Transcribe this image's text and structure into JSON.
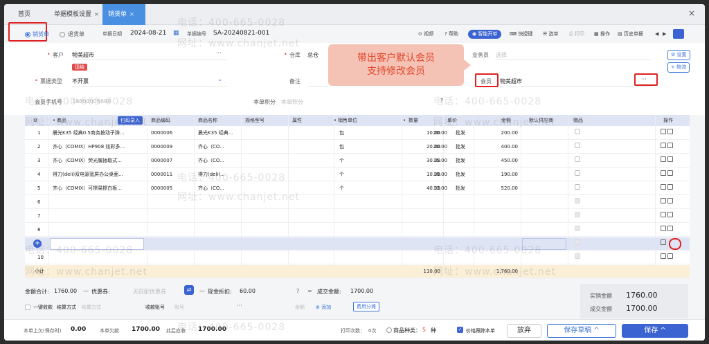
{
  "tabs": [
    {
      "label": "首页"
    },
    {
      "label": "单据模板设置",
      "close": "×"
    },
    {
      "label": "销货单",
      "close": "×"
    }
  ],
  "window_close": "×",
  "toolbar": {
    "doc_type_a": "销货单",
    "doc_type_b": "退货单",
    "date_label": "单据日期",
    "date_value": "2024-08-21",
    "number_label": "单据编号",
    "number_value": "SA-20240821-001",
    "video": "视频",
    "help": "帮助",
    "smart": "智能开单",
    "shortcut": "快捷键",
    "select": "选单",
    "print": "打印",
    "action": "操作",
    "history": "历史单据"
  },
  "form": {
    "customer_label": "客户",
    "customer_value": "物美超市",
    "customer_tag": "现结",
    "warehouse_label": "仓库",
    "warehouse_value": "总仓",
    "salesman_label": "业务员",
    "salesman_placeholder": "选择",
    "invoice_label": "票据类型",
    "invoice_value": "不开票",
    "remark_label": "备注",
    "member_label": "会员",
    "member_value": "物美超市",
    "phone_label": "会员手机号",
    "phone_value": "18800008898",
    "points_label": "本单积分",
    "points_value": "本单积分",
    "more": "···",
    "settings_btn": "设置",
    "logistics_btn": "+ 物流"
  },
  "callout": {
    "line1": "带出客户默认会员",
    "line2": "支持修改会员"
  },
  "table": {
    "headers": {
      "product": "商品",
      "scan": "扫码录入",
      "code": "商品编码",
      "name": "商品名称",
      "spec": "规格型号",
      "attr": "属性",
      "unit": "销售单位",
      "qty": "数量",
      "price": "单价",
      "amount": "金额",
      "supplier": "默认供应商",
      "gift": "赠品",
      "ops": "操作"
    },
    "price_tag": "批发",
    "rows": [
      {
        "no": "1",
        "product": "晨光K35 经典0.5商务按动子弹...",
        "code": "0000006",
        "name": "晨光K35 经典...",
        "unit": "包",
        "qty": "10.00",
        "price": "20.00",
        "amount": "200.00"
      },
      {
        "no": "2",
        "product": "齐心（COMIX）HP908 炫彩多...",
        "code": "0000009",
        "name": "齐心（CO...",
        "unit": "包",
        "qty": "20.00",
        "price": "20.00",
        "amount": "400.00"
      },
      {
        "no": "3",
        "product": "齐心（COMIX）荧光膜抽取式...",
        "code": "0000007",
        "name": "齐心（CO...",
        "unit": "个",
        "qty": "30.00",
        "price": "15.00",
        "amount": "450.00"
      },
      {
        "no": "4",
        "product": "得力(deli)双电源宽屏办公桌面...",
        "code": "0000011",
        "name": "得力(deli)...",
        "unit": "个",
        "qty": "10.00",
        "price": "19.00",
        "amount": "190.00"
      },
      {
        "no": "5",
        "product": "齐心（COMIX）可擦易擦白板...",
        "code": "0000005",
        "name": "齐心（CO...",
        "unit": "个",
        "qty": "40.00",
        "price": "13.00",
        "amount": "520.00"
      }
    ],
    "empty_rows": [
      "6",
      "7",
      "8",
      "",
      "10"
    ],
    "total_label": "小计",
    "total_qty": "110.00",
    "total_amount": "1,760.00"
  },
  "footer": {
    "total_label": "金额合计:",
    "total_value": "1760.00",
    "coupon_label": "优惠券:",
    "coupon_placeholder": "无匹配优惠券",
    "discount_label": "现金折扣:",
    "discount_value": "60.00",
    "deal_label": "成交金额:",
    "deal_value": "1700.00",
    "oneclick": "一键收款",
    "settle_label": "结算方式",
    "settle_placeholder": "结算方式",
    "account_label": "收款账号",
    "account_placeholder": "账号",
    "amount_placeholder": "金额",
    "add": "添加",
    "split": "费用分摊",
    "actual_label": "实销金额",
    "actual_value": "1760.00",
    "deal2_label": "成交金额",
    "deal2_value": "1700.00"
  },
  "bottom": {
    "prev_label": "本单上欠(保存时)",
    "prev_value": "0.00",
    "this_label": "本单欠款",
    "this_value": "1700.00",
    "after_label": "此后应收",
    "after_value": "1700.00",
    "print_count_label": "打印次数：",
    "print_count_value": "0次",
    "kinds_label": "商品种类：",
    "kinds_value": "5",
    "kinds_unit": "种",
    "follow": "价格跟踪本单",
    "abandon": "放弃",
    "save_draft": "保存草稿 ^",
    "save": "保存 ^"
  },
  "watermark": {
    "phone": "电话：400-665-0028",
    "site": "网址：www.chanjet.net"
  },
  "colors": {
    "primary": "#3b63d1",
    "highlight": "#e02020",
    "callout_bg": "#f5c3b5",
    "callout_text": "#e2452b"
  }
}
